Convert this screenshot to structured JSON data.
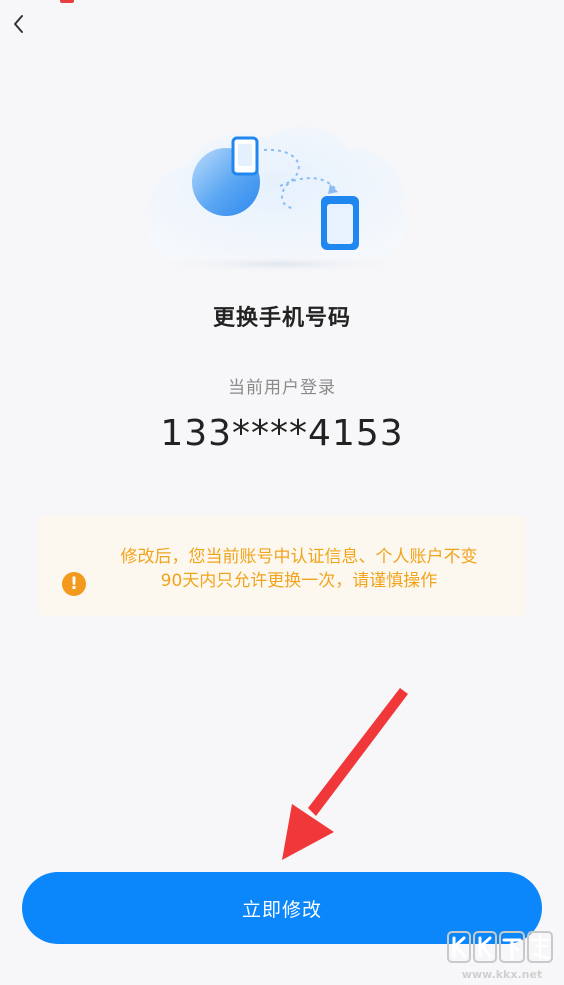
{
  "header": {
    "back_icon": "chevron-left-icon"
  },
  "hero": {
    "illustration": "phone-transfer-illustration"
  },
  "main": {
    "title": "更换手机号码",
    "subtitle": "当前用户登录",
    "phone_number": "133****4153"
  },
  "notice": {
    "icon": "warning-icon",
    "line1": "修改后，您当前账号中认证信息、个人账户不变",
    "line2": "90天内只允许更换一次，请谨慎操作",
    "color": "#f0a41e",
    "background": "#fdf8ef"
  },
  "action": {
    "button_label": "立即修改",
    "button_color": "#0b87fb"
  },
  "watermark": {
    "logo_text": "KK下载",
    "url": "www.kkx.net"
  }
}
